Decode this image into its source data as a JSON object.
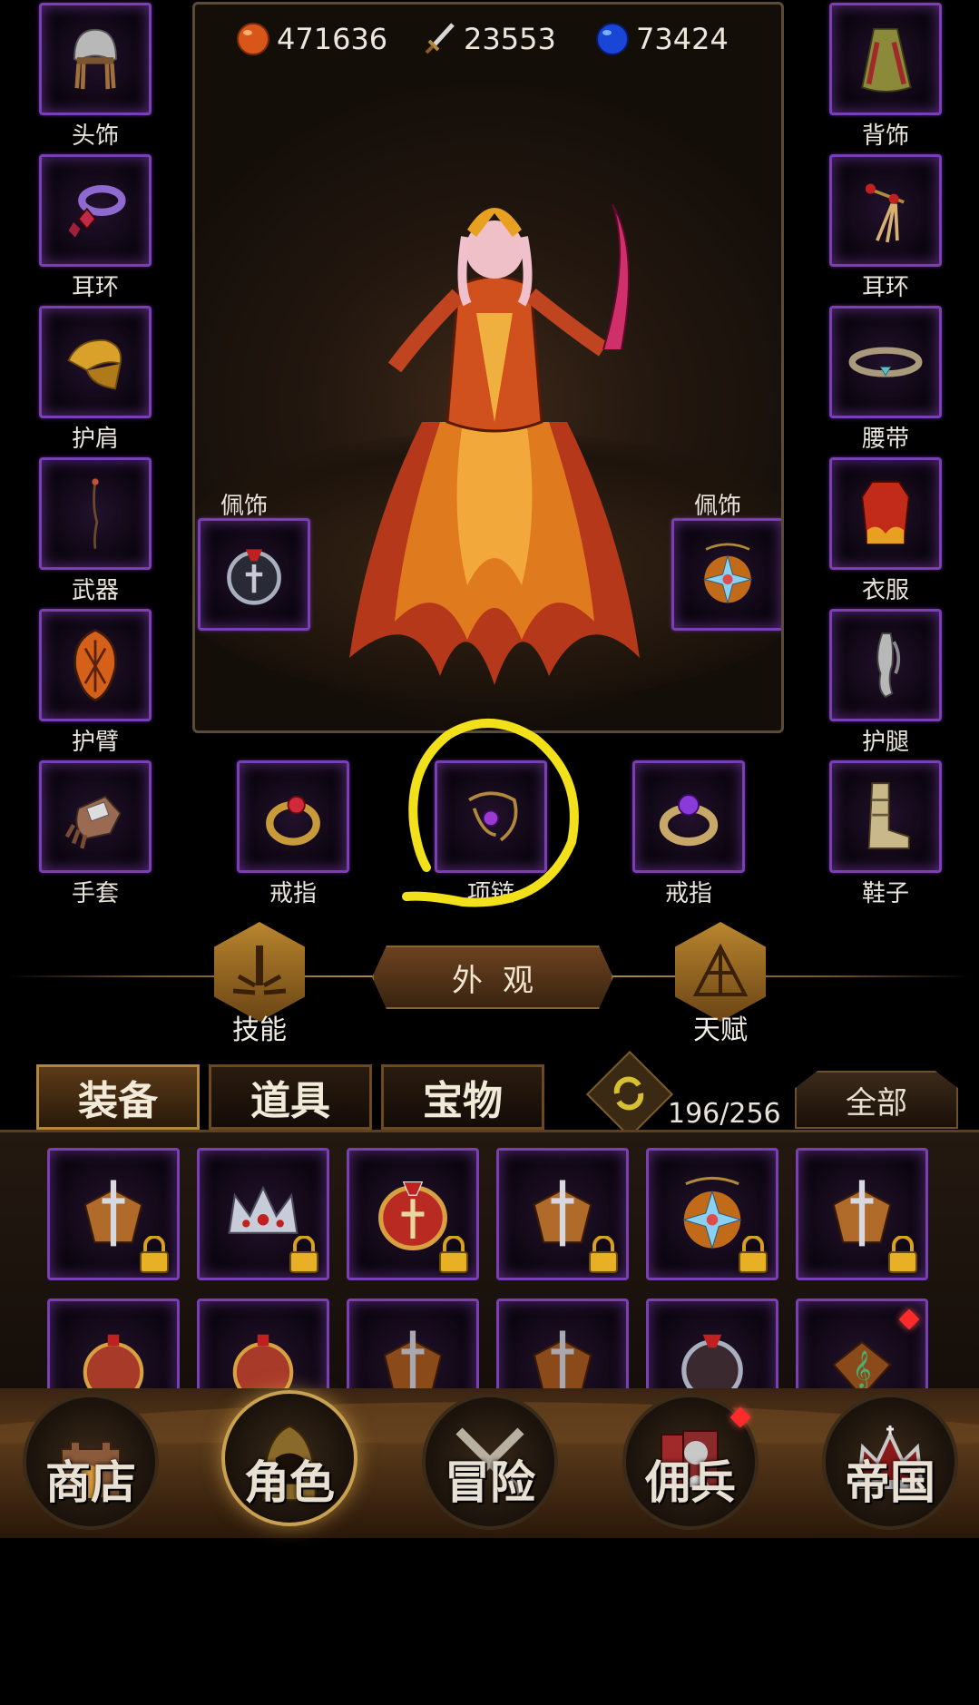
{
  "resources": {
    "orange_amount": "471636",
    "sword_amount": "23553",
    "blue_amount": "73424"
  },
  "equipment": {
    "headwear": "头饰",
    "back": "背饰",
    "earring_left": "耳环",
    "earring_right": "耳环",
    "shoulder": "护肩",
    "belt": "腰带",
    "weapon": "武器",
    "clothes": "衣服",
    "bracer": "护臂",
    "leg_guard": "护腿",
    "gloves": "手套",
    "ring_left": "戒指",
    "necklace": "项链",
    "ring_right": "戒指",
    "shoes": "鞋子",
    "accessory_left": "佩饰",
    "accessory_right": "佩饰"
  },
  "actions": {
    "appearance": "外观",
    "skills": "技能",
    "talent": "天赋"
  },
  "tabs": [
    "装备",
    "道具",
    "宝物"
  ],
  "inventory": {
    "count": "196/256",
    "filter": "全部"
  },
  "nav": [
    "商店",
    "角色",
    "冒险",
    "佣兵",
    "帝国"
  ],
  "colors": {
    "slot_border": "#7a3fb5",
    "highlight_circle": "#f2e11a",
    "gold_accent": "#c9a050"
  }
}
